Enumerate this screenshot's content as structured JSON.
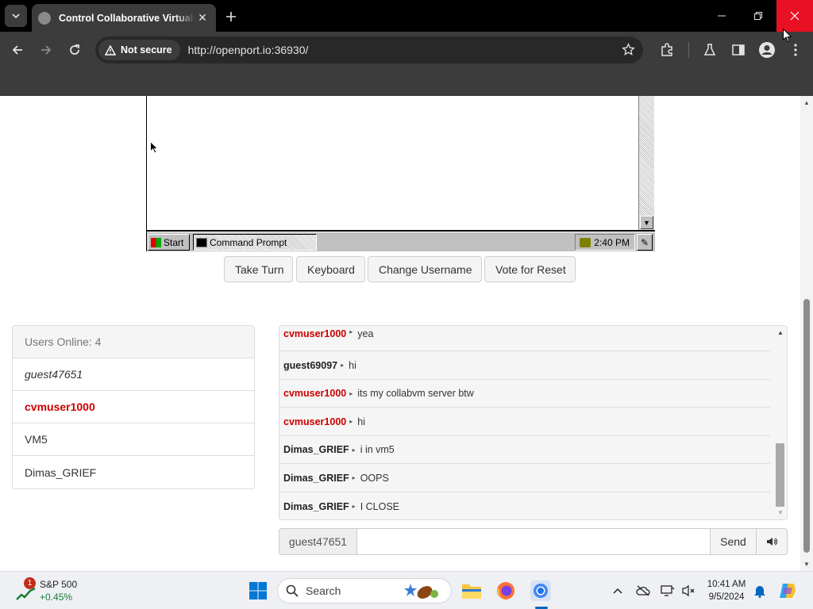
{
  "browser": {
    "tab_title": "Control Collaborative Virtual M",
    "security_label": "Not secure",
    "url": "http://openport.io:36930/"
  },
  "vm": {
    "start_label": "Start",
    "task_item_label": "Command Prompt",
    "clock": "2:40 PM"
  },
  "vm_buttons": [
    "Take Turn",
    "Keyboard",
    "Change Username",
    "Vote for Reset"
  ],
  "users": {
    "header": "Users Online: 4",
    "list": [
      "guest47651",
      "cvmuser1000",
      "VM5",
      "Dimas_GRIEF"
    ]
  },
  "chat": {
    "messages": [
      {
        "user": "cvmuser1000",
        "text": "yea"
      },
      {
        "user": "guest69097",
        "text": "hi"
      },
      {
        "user": "cvmuser1000",
        "text": "its my collabvm server btw"
      },
      {
        "user": "cvmuser1000",
        "text": "hi"
      },
      {
        "user": "Dimas_GRIEF",
        "text": "i in vm5"
      },
      {
        "user": "Dimas_GRIEF",
        "text": "OOPS"
      },
      {
        "user": "Dimas_GRIEF",
        "text": "I CLOSE"
      }
    ],
    "username": "guest47651",
    "input_value": "",
    "send_label": "Send"
  },
  "taskbar": {
    "stock_name": "S&P 500",
    "stock_change": "+0.45%",
    "stock_badge": "1",
    "search_label": "Search",
    "time": "10:41 AM",
    "date": "9/5/2024"
  },
  "colors": {
    "owner_red": "#cc0000",
    "close_red": "#e81123",
    "chrome_dark": "#3c3c3c"
  }
}
